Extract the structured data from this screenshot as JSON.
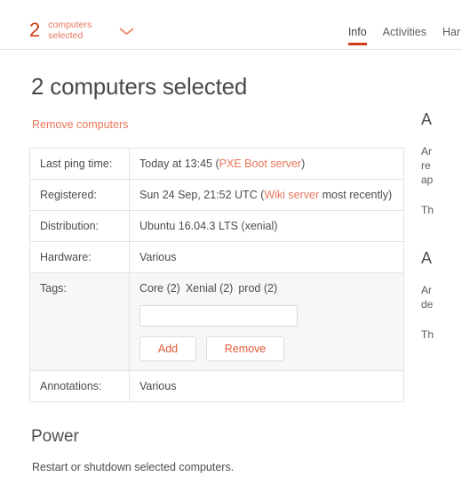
{
  "topbar": {
    "selection_count": "2",
    "selection_label": "computers selected",
    "dropdown_icon": "chevron-down-icon",
    "tabs": [
      {
        "label": "Info",
        "active": true
      },
      {
        "label": "Activities",
        "active": false
      },
      {
        "label": "Har",
        "active": false
      }
    ]
  },
  "page": {
    "title": "2 computers selected",
    "remove_link": "Remove computers"
  },
  "info_table": {
    "rows": [
      {
        "key": "Last ping time:",
        "value_plain": "Today at 13:45 (",
        "value_accent": "PXE Boot server",
        "value_tail": ")"
      },
      {
        "key": "Registered:",
        "value_plain": "Sun 24 Sep, 21:52 UTC (",
        "value_accent": "Wiki server",
        "value_tail": " most recently)"
      },
      {
        "key": "Distribution:",
        "value_plain": "Ubuntu 16.04.3 LTS (xenial)",
        "value_accent": "",
        "value_tail": ""
      },
      {
        "key": "Hardware:",
        "value_plain": "Various",
        "value_accent": "",
        "value_tail": ""
      }
    ],
    "tags_row": {
      "key": "Tags:",
      "tags": [
        "Core (2)",
        "Xenial (2)",
        "prod (2)"
      ],
      "input_value": "",
      "input_placeholder": "",
      "add_button": "Add",
      "remove_button": "Remove"
    },
    "annotations_row": {
      "key": "Annotations:",
      "value_plain": "Various"
    }
  },
  "power": {
    "title": "Power",
    "description": "Restart or shutdown selected computers."
  },
  "sidebar_clipped": {
    "block1": {
      "heading": "A",
      "line1": "Ar",
      "line2": "re",
      "line3": "ap",
      "line4": "Th"
    },
    "block2": {
      "heading": "A",
      "line1": "Ar",
      "line2": "de",
      "line3": "Th"
    }
  },
  "colors": {
    "accent_strong": "#cf3c1c",
    "accent_light": "#e8755a",
    "tab_underline": "#d03c1a",
    "button_text": "#e05a36",
    "border": "#e3e3e3",
    "row_highlight": "#f7f7f7"
  }
}
